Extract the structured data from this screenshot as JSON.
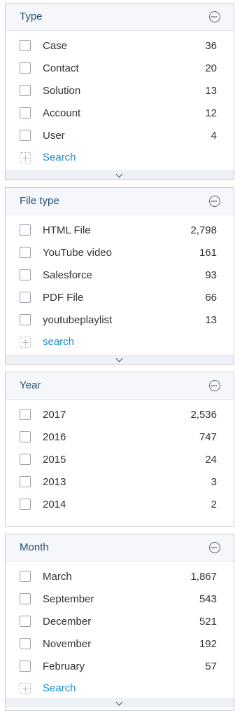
{
  "facets": [
    {
      "title": "Type",
      "items": [
        {
          "label": "Case",
          "count": "36"
        },
        {
          "label": "Contact",
          "count": "20"
        },
        {
          "label": "Solution",
          "count": "13"
        },
        {
          "label": "Account",
          "count": "12"
        },
        {
          "label": "User",
          "count": "4"
        }
      ],
      "search_label": "Search"
    },
    {
      "title": "File type",
      "items": [
        {
          "label": "HTML File",
          "count": "2,798"
        },
        {
          "label": "YouTube video",
          "count": "161"
        },
        {
          "label": "Salesforce",
          "count": "93"
        },
        {
          "label": "PDF File",
          "count": "66"
        },
        {
          "label": "youtubeplaylist",
          "count": "13"
        }
      ],
      "search_label": "search"
    },
    {
      "title": "Year",
      "items": [
        {
          "label": "2017",
          "count": "2,536"
        },
        {
          "label": "2016",
          "count": "747"
        },
        {
          "label": "2015",
          "count": "24"
        },
        {
          "label": "2013",
          "count": "3"
        },
        {
          "label": "2014",
          "count": "2"
        }
      ]
    },
    {
      "title": "Month",
      "items": [
        {
          "label": "March",
          "count": "1,867"
        },
        {
          "label": "September",
          "count": "543"
        },
        {
          "label": "December",
          "count": "521"
        },
        {
          "label": "November",
          "count": "192"
        },
        {
          "label": "February",
          "count": "57"
        }
      ],
      "search_label": "Search"
    }
  ]
}
